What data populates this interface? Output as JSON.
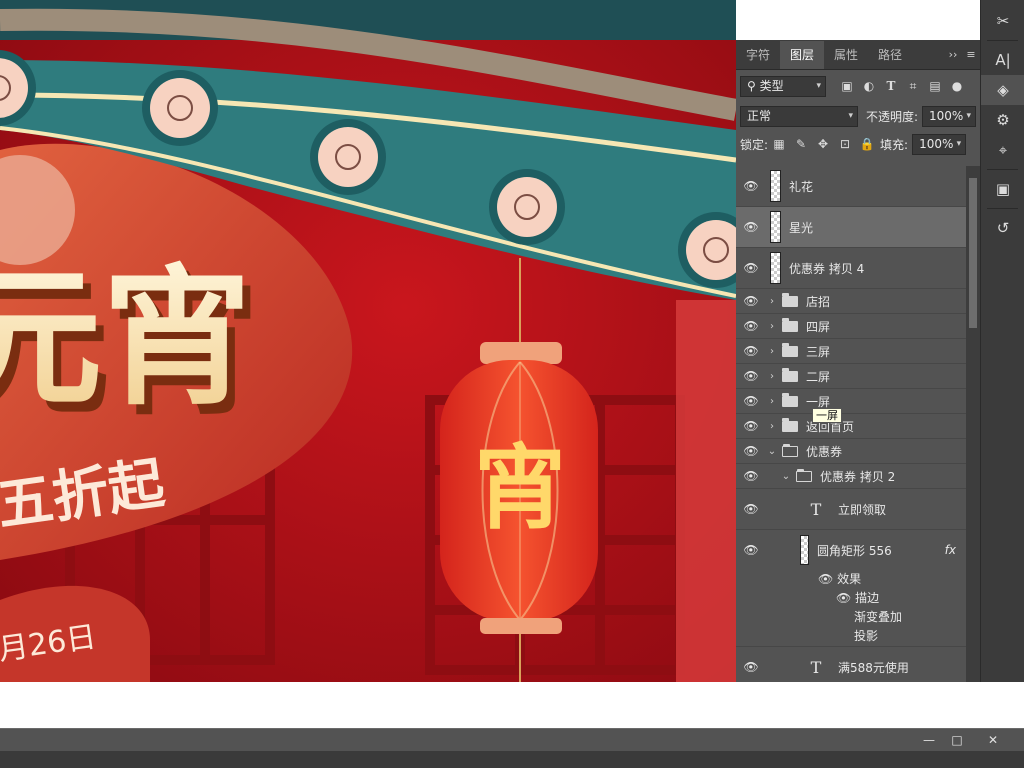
{
  "colors": {
    "panel_bg": "#535353",
    "panel_dark": "#3c3c3c",
    "selected_row": "#6b6b6b",
    "canvas_red": "#b0141a",
    "eave_teal": "#2f7c7e",
    "lantern_red": "#e7362a",
    "lantern_gold": "#f3d27a"
  },
  "canvas": {
    "headline": "元宵",
    "discount": "五折起",
    "date": "月26日",
    "lantern_char": "宵"
  },
  "panel": {
    "tabs": [
      "字符",
      "图层",
      "属性",
      "路径"
    ],
    "active_tab": "图层",
    "menu_glyph": "≡",
    "collapse_glyph": "››",
    "filter_label": "类型",
    "blend_mode": "正常",
    "opacity_label": "不透明度:",
    "opacity_value": "100%",
    "lock_label": "锁定:",
    "fill_label": "填充:",
    "fill_value": "100%"
  },
  "layers": [
    {
      "name": "礼花",
      "kind": "pixel",
      "visible": true,
      "selected": false,
      "indent": 0
    },
    {
      "name": "星光",
      "kind": "pixel",
      "visible": true,
      "selected": true,
      "indent": 0
    },
    {
      "name": "优惠券 拷贝 4",
      "kind": "pixel",
      "visible": true,
      "selected": false,
      "indent": 0
    },
    {
      "name": "店招",
      "kind": "group",
      "visible": true,
      "expanded": false,
      "indent": 0
    },
    {
      "name": "四屏",
      "kind": "group",
      "visible": true,
      "expanded": false,
      "indent": 0
    },
    {
      "name": "三屏",
      "kind": "group",
      "visible": true,
      "expanded": false,
      "indent": 0
    },
    {
      "name": "二屏",
      "kind": "group",
      "visible": true,
      "expanded": false,
      "indent": 0
    },
    {
      "name": "一屏",
      "kind": "group",
      "visible": true,
      "expanded": false,
      "indent": 0
    },
    {
      "name": "返回首页",
      "kind": "group",
      "visible": true,
      "expanded": false,
      "indent": 0
    },
    {
      "name": "优惠券",
      "kind": "group",
      "visible": true,
      "expanded": true,
      "indent": 0
    },
    {
      "name": "优惠券 拷贝 2",
      "kind": "group",
      "visible": true,
      "expanded": true,
      "indent": 1
    },
    {
      "name": "立即领取",
      "kind": "text",
      "visible": true,
      "indent": 2
    },
    {
      "name": "圆角矩形 556",
      "kind": "shape",
      "visible": true,
      "indent": 2,
      "has_fx": true
    },
    {
      "name": "满588元使用",
      "kind": "text",
      "visible": true,
      "indent": 2
    }
  ],
  "effects": {
    "header": "效果",
    "items": [
      "描边",
      "渐变叠加",
      "投影"
    ],
    "fx_label": "fx"
  },
  "tooltip": "一屏",
  "window_controls": {
    "minimize": "—",
    "restore": "□",
    "close": "✕"
  }
}
